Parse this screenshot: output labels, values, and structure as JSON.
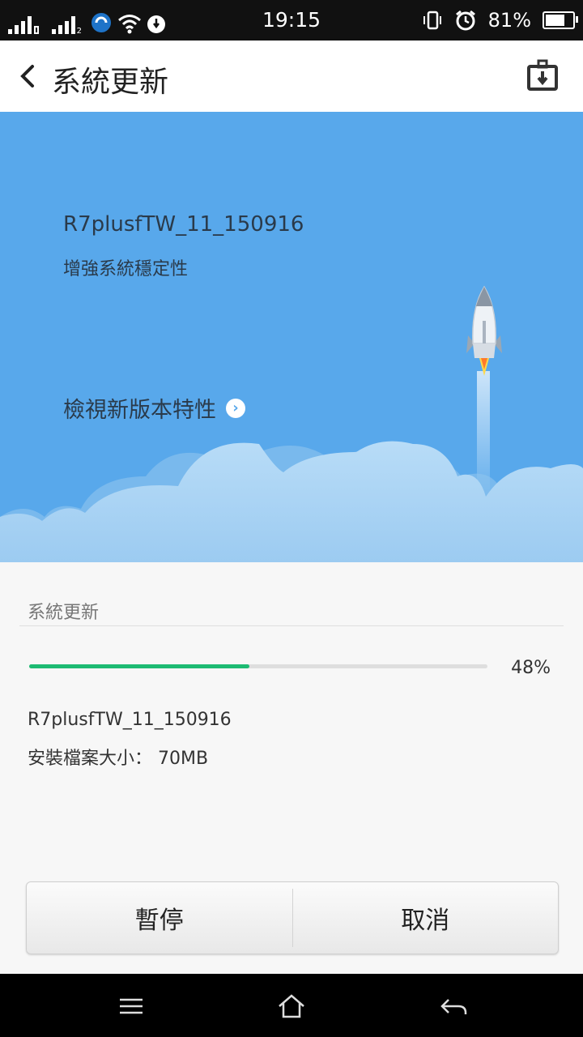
{
  "status": {
    "time": "19:15",
    "battery": "81%",
    "battery_level": 0.81,
    "sim2_label": "2"
  },
  "header": {
    "title": "系統更新",
    "back_icon": "chevron-left-icon",
    "tool_icon": "toolbox-icon"
  },
  "hero": {
    "version": "R7plusfTW_11_150916",
    "description": "增強系統穩定性",
    "features_link": "檢視新版本特性",
    "link_icon": "chevron-right-circle-icon",
    "background": "#58a8eb"
  },
  "update": {
    "section_title": "系統更新",
    "progress": 48,
    "progress_label": "48%",
    "package_name": "R7plusfTW_11_150916",
    "size_text": "安裝檔案大小： 70MB",
    "accent": "#1dbb73"
  },
  "buttons": {
    "pause": "暫停",
    "cancel": "取消"
  },
  "navbar": {
    "menu_icon": "menu-icon",
    "home_icon": "home-icon",
    "back_icon": "back-arrow-icon"
  }
}
